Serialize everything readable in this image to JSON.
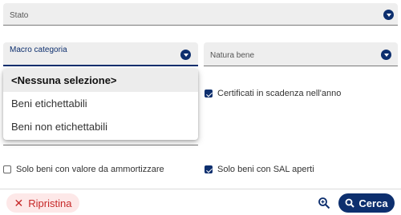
{
  "fields": {
    "stato": {
      "label": "Stato"
    },
    "macro_categoria": {
      "label": "Macro categoria"
    },
    "natura_bene": {
      "label": "Natura bene"
    }
  },
  "dropdown": {
    "options": [
      {
        "label": "<Nessuna selezione>"
      },
      {
        "label": "Beni etichettabili"
      },
      {
        "label": "Beni non etichettabili"
      }
    ]
  },
  "checkboxes": {
    "certificati": {
      "label": "Certificati in scadenza nell'anno",
      "checked": true
    },
    "ammortizzare": {
      "label": "Solo beni con valore da ammortizzare",
      "checked": false
    },
    "sal_aperti": {
      "label": "Solo beni con SAL aperti",
      "checked": true
    }
  },
  "actions": {
    "reset_label": "Ripristina",
    "search_label": "Cerca"
  },
  "icons": {
    "dropdown": "chevron-down-circle-icon",
    "reset": "close-icon",
    "zoom": "zoom-in-icon",
    "search": "search-icon"
  },
  "colors": {
    "primary": "#0d2f6e",
    "danger": "#c62828",
    "danger_bg": "#fde8e8",
    "field_bg": "#eeeeee"
  }
}
